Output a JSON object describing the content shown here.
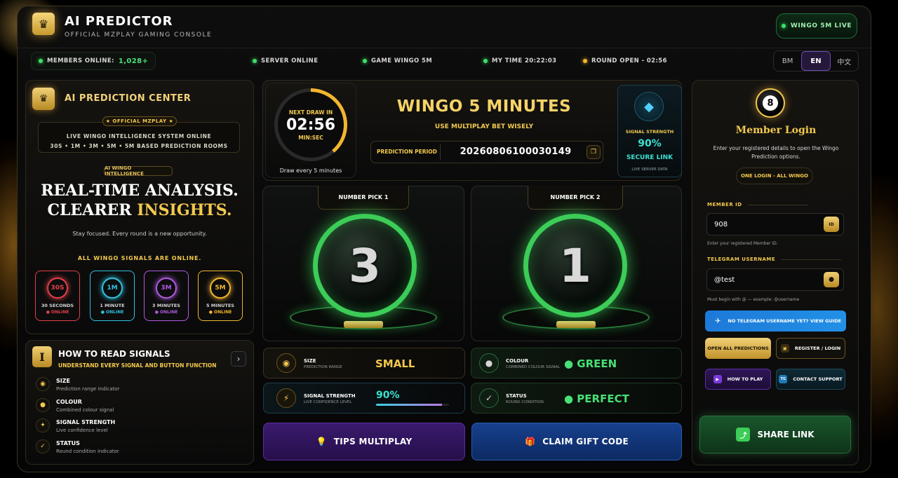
{
  "header": {
    "title": "AI PREDICTOR",
    "subtitle": "OFFICIAL MZPLAY GAMING CONSOLE",
    "live_pill": "WINGO 5M LIVE"
  },
  "status": {
    "members_label": "MEMBERS ONLINE:",
    "members_count": "1,028+",
    "server": "SERVER ONLINE",
    "game": "GAME WINGO 5M",
    "my_time": "MY TIME 20:22:03",
    "round_open": "ROUND OPEN - 02:56"
  },
  "languages": [
    {
      "label": "BM"
    },
    {
      "label": "EN",
      "active": true
    },
    {
      "label": "中文"
    }
  ],
  "left_panel": {
    "title": "AI PREDICTION CENTER",
    "official_tag": "★ OFFICIAL MZPLAY ★",
    "info_line1": "LIVE WINGO INTELLIGENCE SYSTEM ONLINE",
    "info_line2": "30S • 1M • 3M • 5M • 5M BASED PREDICTION ROOMS",
    "ai_tag": "AI WINGO INTELLIGENCE",
    "headline_line1": "REAL-TIME ANALYSIS.",
    "headline_line2a": "CLEARER ",
    "headline_line2b": "INSIGHTS.",
    "tagline": "Stay focused. Every round is a new opportunity.",
    "signals_online": "ALL WINGO SIGNALS ARE ONLINE.",
    "rooms": [
      {
        "code": "30S",
        "name": "30 SECONDS",
        "status": "● ONLINE",
        "color": "#e0404a"
      },
      {
        "code": "1M",
        "name": "1 MINUTE",
        "status": "● ONLINE",
        "color": "#2fc4e0"
      },
      {
        "code": "3M",
        "name": "3 MINUTES",
        "status": "● ONLINE",
        "color": "#b05ae0"
      },
      {
        "code": "5M",
        "name": "5 MINUTES",
        "status": "● ONLINE",
        "color": "#f3b62e"
      }
    ]
  },
  "how_to": {
    "icon_letter": "I",
    "title": "HOW TO READ SIGNALS",
    "subtitle": "UNDERSTAND EVERY SIGNAL AND BUTTON FUNCTION",
    "items": [
      {
        "title": "SIZE",
        "desc": "Prediction range indicator",
        "icon": "eye-icon"
      },
      {
        "title": "COLOUR",
        "desc": "Combined colour signal",
        "icon": "palette-icon"
      },
      {
        "title": "SIGNAL STRENGTH",
        "desc": "Live confidence level",
        "icon": "bolt-icon"
      },
      {
        "title": "STATUS",
        "desc": "Round condition indicator",
        "icon": "check-icon"
      }
    ]
  },
  "timer": {
    "label": "NEXT DRAW IN",
    "value": "02:56",
    "unit": "MIN:SEC",
    "progress": 0.39,
    "draw_every": "Draw every 5 minutes"
  },
  "game": {
    "title": "WINGO 5 MINUTES",
    "subtitle": "USE MULTIPLAY BET WISELY",
    "period_label": "PREDICTION PERIOD",
    "period_value": "20260806100030149"
  },
  "signal": {
    "label": "SIGNAL STRENGTH",
    "value": "90%",
    "secure": "SECURE LINK",
    "server": "LIVE SERVER DATA"
  },
  "picks": [
    {
      "label": "NUMBER PICK 1",
      "number": "3"
    },
    {
      "label": "NUMBER PICK 2",
      "number": "1"
    }
  ],
  "stats": {
    "size": {
      "label": "SIZE",
      "desc": "PREDICTION RANGE",
      "value": "SMALL"
    },
    "colour": {
      "label": "COLOUR",
      "desc": "COMBINED COLOUR SIGNAL",
      "value": "● GREEN"
    },
    "strength": {
      "label": "SIGNAL STRENGTH",
      "desc": "LIVE CONFIDENCE LEVEL",
      "value": "90%",
      "level": 0.9
    },
    "status": {
      "label": "STATUS",
      "desc": "ROUND CONDITION",
      "value": "● PERFECT"
    }
  },
  "actions": {
    "tips": "TIPS MULTIPLAY",
    "gift": "CLAIM GIFT CODE"
  },
  "login": {
    "ball_number": "8",
    "title": "Member Login",
    "desc": "Enter your registered details to open the Wingo Prediction options.",
    "one_login": "ONE LOGIN - ALL WINGO",
    "member_id_label": "MEMBER ID",
    "member_id_value": "908",
    "member_id_btn": "ID",
    "member_id_hint": "Enter your registered Member ID.",
    "telegram_label": "TELEGRAM USERNAME",
    "telegram_value": "@test",
    "telegram_hint": "Must begin with @ — example: @username",
    "tg_guide": "NO TELEGRAM USERNAME YET? VIEW GUIDE",
    "open_all": "OPEN ALL PREDICTIONS",
    "register": "REGISTER / LOGIN",
    "how_to_play": "HOW TO PLAY",
    "contact": "CONTACT SUPPORT",
    "share": "SHARE LINK"
  }
}
